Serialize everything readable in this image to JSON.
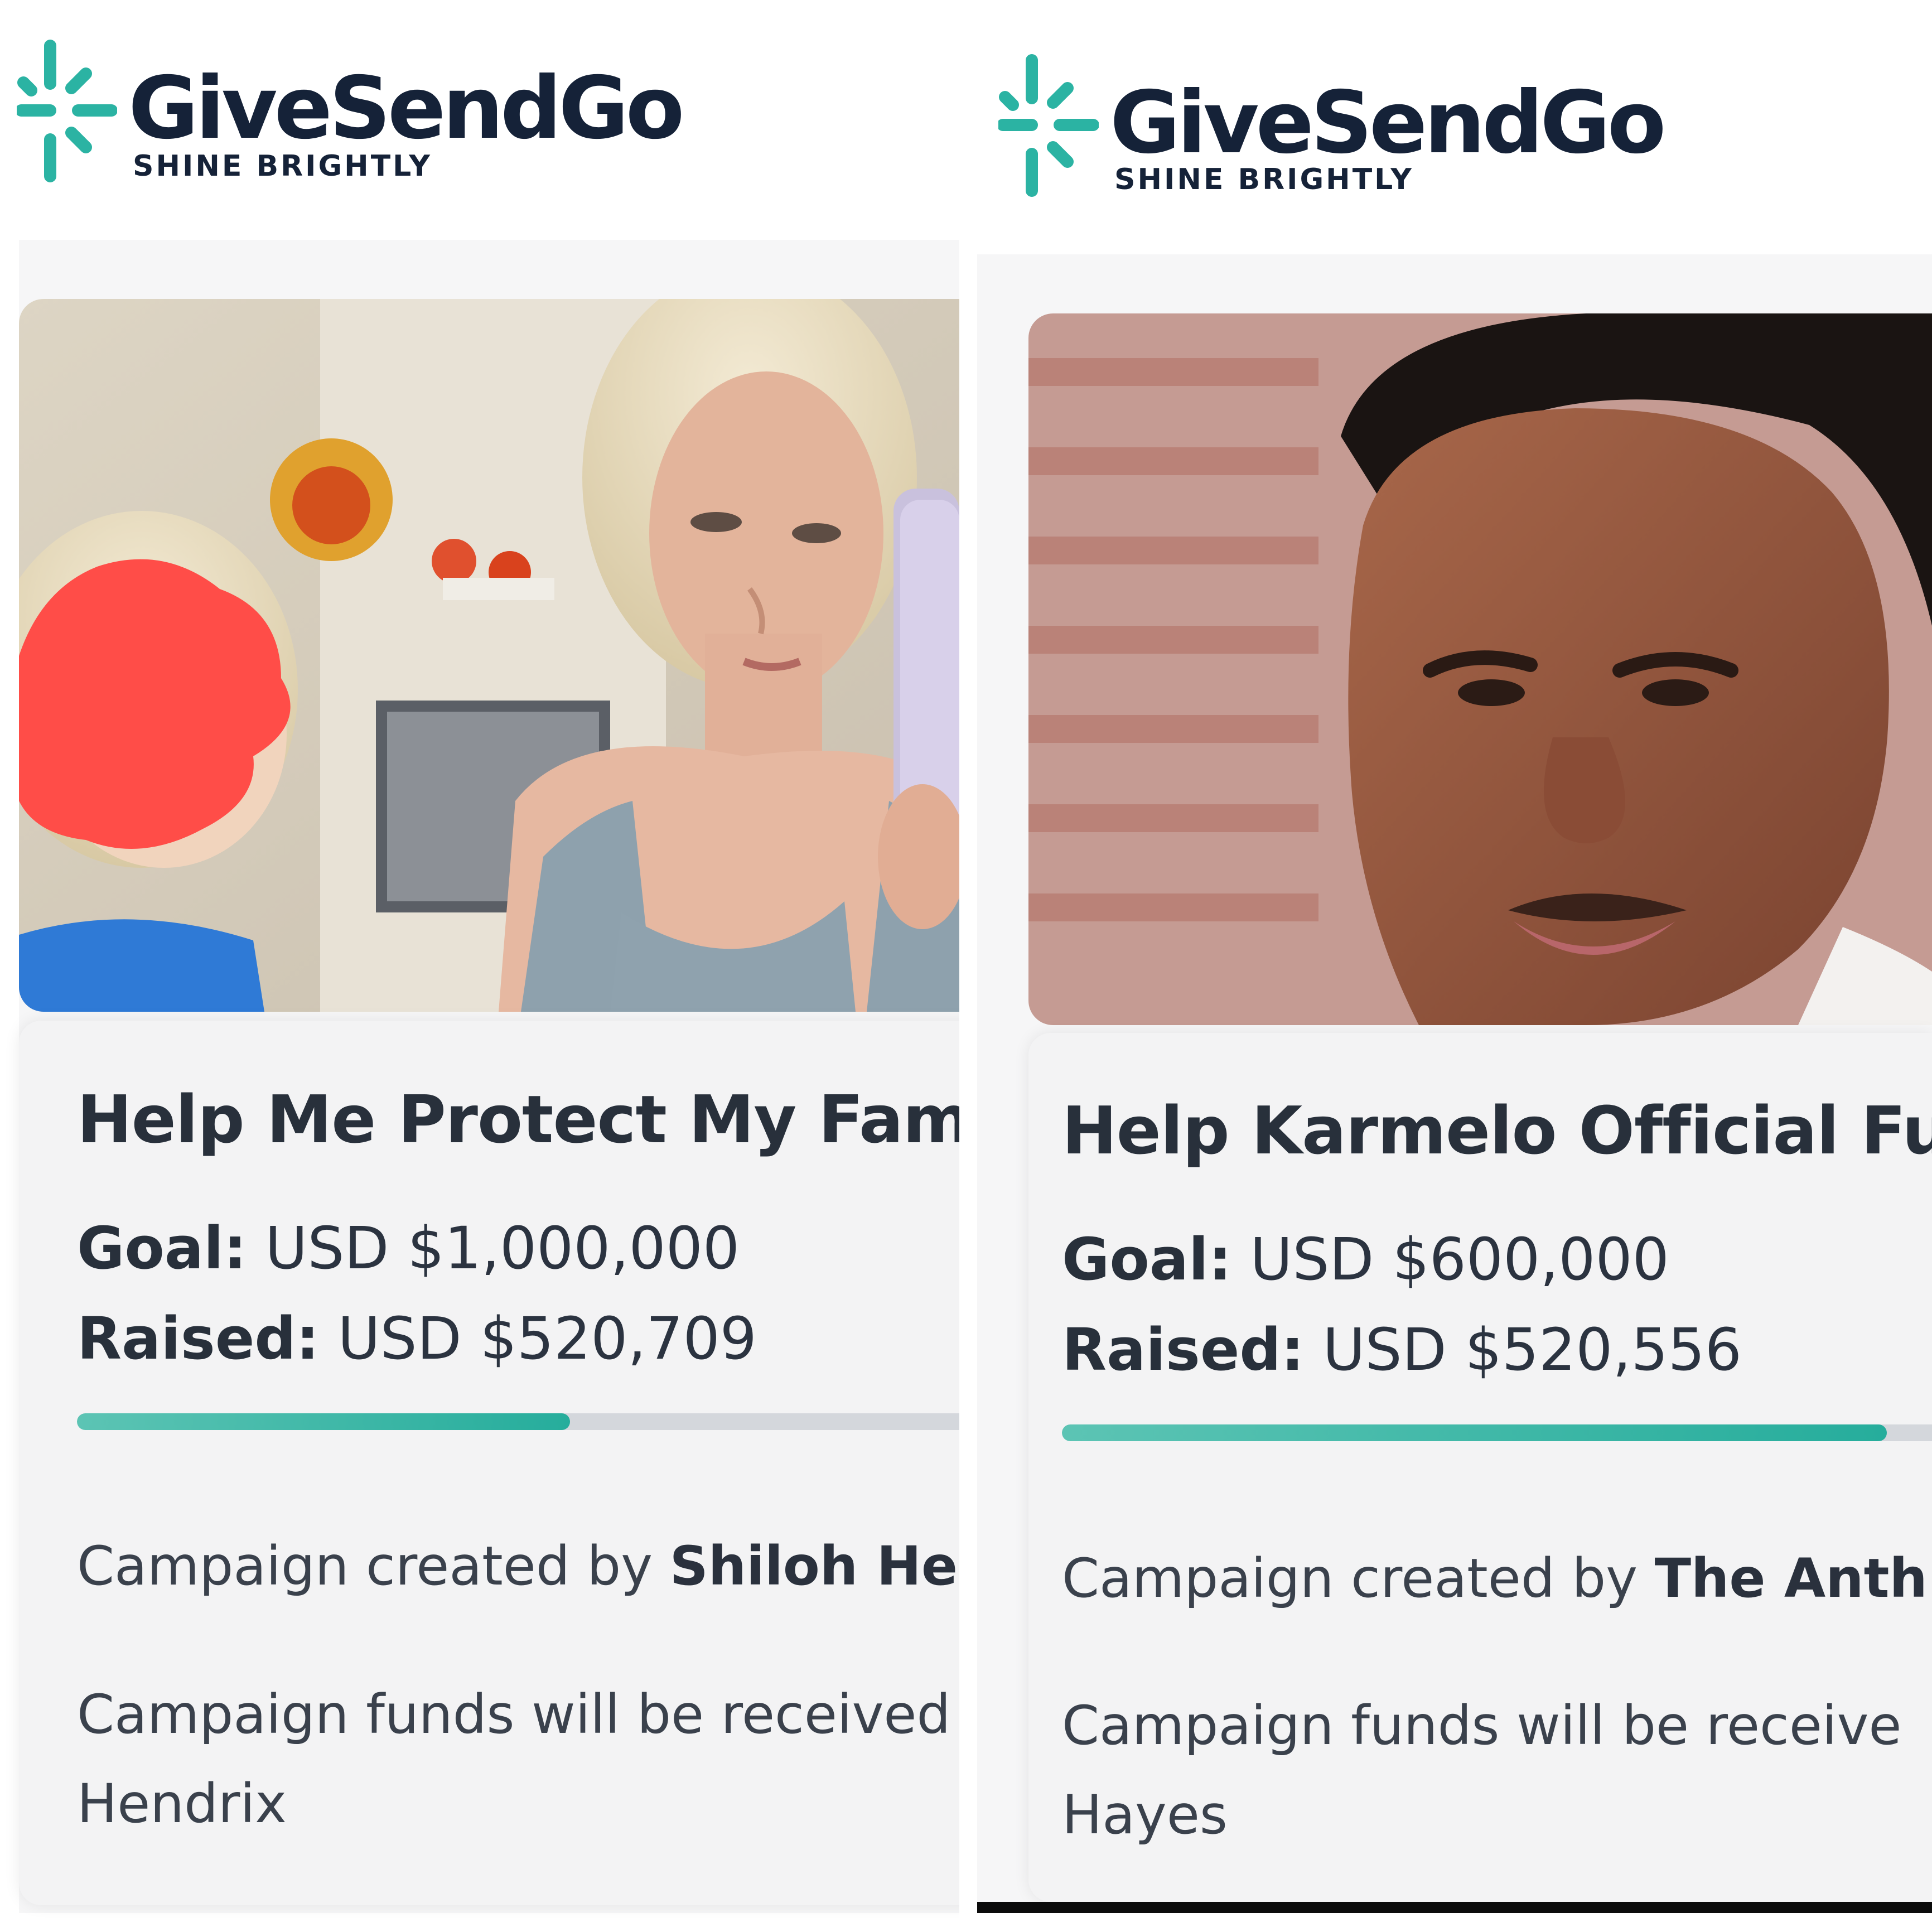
{
  "brand": {
    "name": "GiveSendGo",
    "tagline": "SHINE BRIGHTLY",
    "accent_color": "#2bb3a3",
    "text_color": "#152238"
  },
  "campaigns": [
    {
      "title": "Help Me Protect My Famil",
      "goal_label": "Goal:",
      "goal_value": "USD $1,000,000",
      "raised_label": "Raised:",
      "raised_value": "USD $520,709",
      "progress_fraction": 0.52,
      "created_prefix": "Campaign created by",
      "created_by": "Shiloh Hen",
      "funds_line1": "Campaign funds will be received",
      "funds_line2": "Hendrix"
    },
    {
      "title": "Help Karmelo Official Fu",
      "goal_label": "Goal:",
      "goal_value": "USD $600,000",
      "raised_label": "Raised:",
      "raised_value": "USD $520,556",
      "progress_fraction": 0.87,
      "created_prefix": "Campaign created by",
      "created_by": "The Anth",
      "funds_line1": "Campaign funds will be receive",
      "funds_line2": "Hayes"
    }
  ]
}
